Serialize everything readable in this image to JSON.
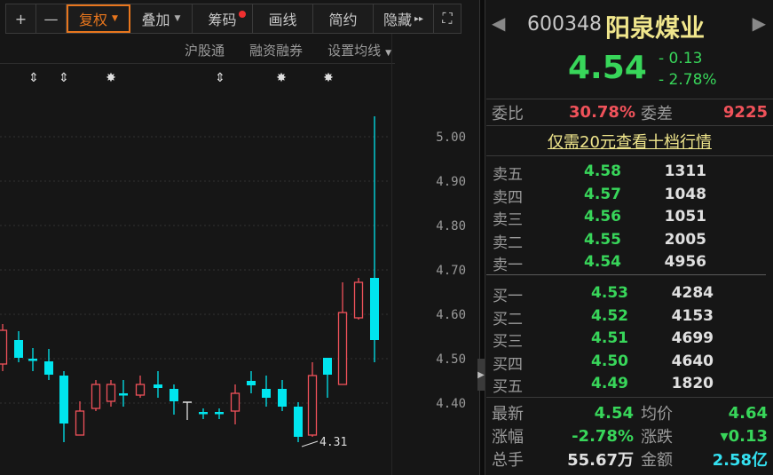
{
  "toolbar": {
    "zoom_in": "+",
    "zoom_out": "—",
    "fuquan": "复权",
    "overlay": "叠加",
    "chips": "筹码",
    "draw": "画线",
    "simple": "简约",
    "hide": "隐藏",
    "hide_arrow": "▸▸",
    "fullscreen": "⛶"
  },
  "subbar": {
    "hgt": "沪股通",
    "margin": "融资融券",
    "ma_setting": "设置均线"
  },
  "events": [
    {
      "type": "arrow",
      "label": "⇕"
    },
    {
      "type": "arrow",
      "label": "⇕"
    },
    {
      "type": "star",
      "label": "✸"
    },
    {
      "type": "arrow",
      "label": "⇕"
    },
    {
      "type": "star",
      "label": "✸"
    },
    {
      "type": "star",
      "label": "✸"
    }
  ],
  "chart_data": {
    "type": "candlestick",
    "ylim": [
      4.3,
      5.05
    ],
    "yticks": [
      "5.00",
      "4.90",
      "4.80",
      "4.70",
      "4.60",
      "4.50",
      "4.40"
    ],
    "low_annotation": "4.31",
    "colors": {
      "up": "#f0525a",
      "down": "#00e5ee",
      "flat": "#e0e0e0"
    },
    "candles": [
      [
        4.488,
        4.578,
        4.472,
        4.564
      ],
      [
        4.542,
        4.562,
        4.492,
        4.502
      ],
      [
        4.498,
        4.524,
        4.472,
        4.498
      ],
      [
        4.494,
        4.522,
        4.452,
        4.464
      ],
      [
        4.462,
        4.472,
        4.312,
        4.354
      ],
      [
        4.328,
        4.404,
        4.328,
        4.382
      ],
      [
        4.388,
        4.452,
        4.382,
        4.442
      ],
      [
        4.404,
        4.452,
        4.392,
        4.442
      ],
      [
        4.42,
        4.452,
        4.392,
        4.42
      ],
      [
        4.418,
        4.462,
        4.412,
        4.442
      ],
      [
        4.442,
        4.472,
        4.412,
        4.434
      ],
      [
        4.432,
        4.442,
        4.374,
        4.404
      ],
      [
        4.402,
        4.402,
        4.362,
        4.402
      ],
      [
        4.378,
        4.388,
        4.364,
        4.376
      ],
      [
        4.378,
        4.388,
        4.364,
        4.376
      ],
      [
        4.382,
        4.442,
        4.352,
        4.422
      ],
      [
        4.45,
        4.472,
        4.422,
        4.44
      ],
      [
        4.432,
        4.462,
        4.392,
        4.412
      ],
      [
        4.432,
        4.452,
        4.382,
        4.392
      ],
      [
        4.392,
        4.402,
        4.312,
        4.324
      ],
      [
        4.328,
        4.492,
        4.324,
        4.462
      ],
      [
        4.502,
        4.502,
        4.412,
        4.464
      ],
      [
        4.442,
        4.672,
        4.442,
        4.604
      ],
      [
        4.592,
        4.682,
        4.588,
        4.672
      ],
      [
        4.682,
        5.046,
        4.492,
        4.542
      ]
    ]
  },
  "quote": {
    "code": "600348",
    "name": "阳泉煤业",
    "price": "4.54",
    "change": "- 0.13",
    "change_pct": "- 2.78%"
  },
  "weibi": {
    "label1": "委比",
    "value1": "30.78%",
    "label2": "委差",
    "value2": "9225"
  },
  "promo": "仅需20元查看十档行情",
  "sell": [
    {
      "label": "卖五",
      "price": "4.58",
      "vol": "1311"
    },
    {
      "label": "卖四",
      "price": "4.57",
      "vol": "1048"
    },
    {
      "label": "卖三",
      "price": "4.56",
      "vol": "1051"
    },
    {
      "label": "卖二",
      "price": "4.55",
      "vol": "2005"
    },
    {
      "label": "卖一",
      "price": "4.54",
      "vol": "4956"
    }
  ],
  "buy": [
    {
      "label": "买一",
      "price": "4.53",
      "vol": "4284"
    },
    {
      "label": "买二",
      "price": "4.52",
      "vol": "4153"
    },
    {
      "label": "买三",
      "price": "4.51",
      "vol": "4699"
    },
    {
      "label": "买四",
      "price": "4.50",
      "vol": "4640"
    },
    {
      "label": "买五",
      "price": "4.49",
      "vol": "1820"
    }
  ],
  "stats": [
    {
      "l1": "最新",
      "v1": "4.54",
      "l2": "均价",
      "v2": "4.64"
    },
    {
      "l1": "涨幅",
      "v1": "-2.78%",
      "l2": "涨跌",
      "v2": "▾0.13"
    },
    {
      "l1": "总手",
      "v1": "55.67万",
      "l2": "金额",
      "v2": "2.58亿"
    }
  ]
}
